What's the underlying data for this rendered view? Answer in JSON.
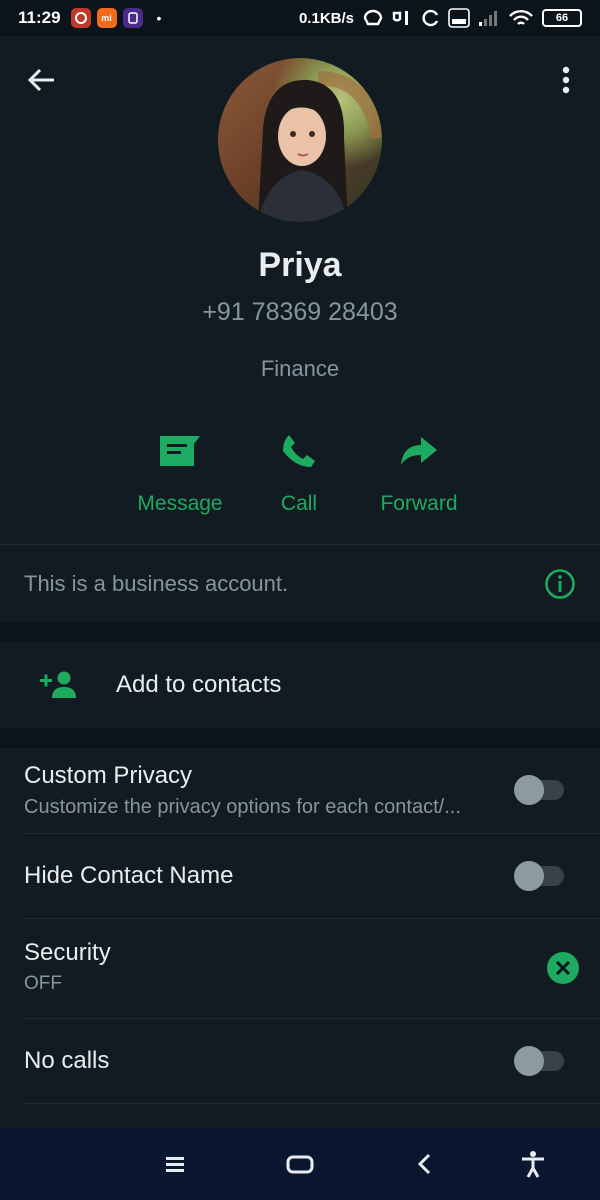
{
  "status_bar": {
    "time": "11:29",
    "network_speed": "0.1KB/s",
    "volte": "Vo LTE",
    "battery": "66",
    "app_icons": [
      "mi"
    ],
    "dot": "•"
  },
  "contact": {
    "name": "Priya",
    "phone": "+91 78369 28403",
    "category": "Finance"
  },
  "actions": [
    {
      "label": "Message",
      "icon": "message-icon"
    },
    {
      "label": "Call",
      "icon": "phone-icon"
    },
    {
      "label": "Forward",
      "icon": "forward-icon"
    }
  ],
  "business_notice": {
    "text": "This is a business account.",
    "icon": "info-icon"
  },
  "add_contacts": {
    "label": "Add to contacts",
    "icon": "add-person-icon"
  },
  "settings": {
    "custom_privacy": {
      "title": "Custom Privacy",
      "subtitle": "Customize the privacy options for each contact/...",
      "enabled": false
    },
    "hide_contact_name": {
      "title": "Hide Contact Name",
      "enabled": false
    },
    "security": {
      "title": "Security",
      "value": "OFF",
      "icon": "close-icon"
    },
    "no_calls": {
      "title": "No calls",
      "enabled": false
    }
  },
  "colors": {
    "accent": "#1daa61",
    "background": "#111b21",
    "secondary_text": "#8696a0"
  }
}
